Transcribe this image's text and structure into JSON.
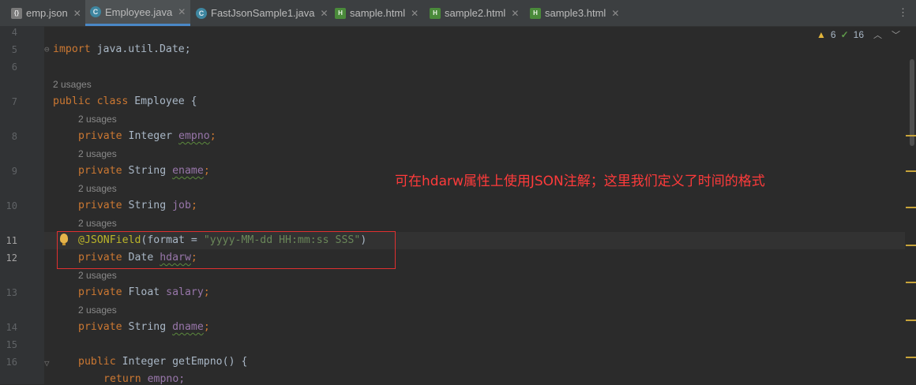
{
  "tabs": [
    {
      "label": "emp.json",
      "icon": "json-file-icon",
      "active": false
    },
    {
      "label": "Employee.java",
      "icon": "java-class-icon",
      "active": true
    },
    {
      "label": "FastJsonSample1.java",
      "icon": "java-class-icon",
      "active": false
    },
    {
      "label": "sample.html",
      "icon": "html-file-icon",
      "active": false
    },
    {
      "label": "sample2.html",
      "icon": "html-file-icon",
      "active": false
    },
    {
      "label": "sample3.html",
      "icon": "html-file-icon",
      "active": false
    }
  ],
  "inspections": {
    "warnings": "6",
    "weak_warnings": "16"
  },
  "line_numbers": [
    "4",
    "5",
    "6",
    "7",
    "8",
    "9",
    "10",
    "11",
    "12",
    "13",
    "14",
    "15",
    "16"
  ],
  "usages_label": "2 usages",
  "code": {
    "import_kw": "import",
    "import_path": " java.util.Date;",
    "class_decl_kw": "public class",
    "class_name": " Employee {",
    "private_kw": "private",
    "field_empno_type": " Integer ",
    "field_empno_name": "empno",
    "field_ename_type": " String ",
    "field_ename_name": "ename",
    "field_job_type": " String ",
    "field_job_name": "job",
    "annotation": "@JSONField",
    "annotation_args_open": "(format = ",
    "annotation_string": "\"yyyy-MM-dd HH:mm:ss SSS\"",
    "annotation_args_close": ")",
    "field_hdarw_type": " Date ",
    "field_hdarw_name": "hdarw",
    "field_salary_type": " Float ",
    "field_salary_name": "salary",
    "field_dname_type": " String ",
    "field_dname_name": "dname",
    "semicolon": ";",
    "method_kw": "public",
    "method_ret": " Integer ",
    "method_name": "getEmpno",
    "method_rest": "() {",
    "return_kw": "return",
    "return_val": " empno;"
  },
  "annotation_note": "可在hdarw属性上使用JSON注解；这里我们定义了时间的格式",
  "colors": {
    "note": "#ff3b3b",
    "highlight_box": "#e03030",
    "keyword": "#cc7832",
    "field": "#9876aa",
    "annotation": "#bbb529",
    "string": "#6a8759"
  }
}
